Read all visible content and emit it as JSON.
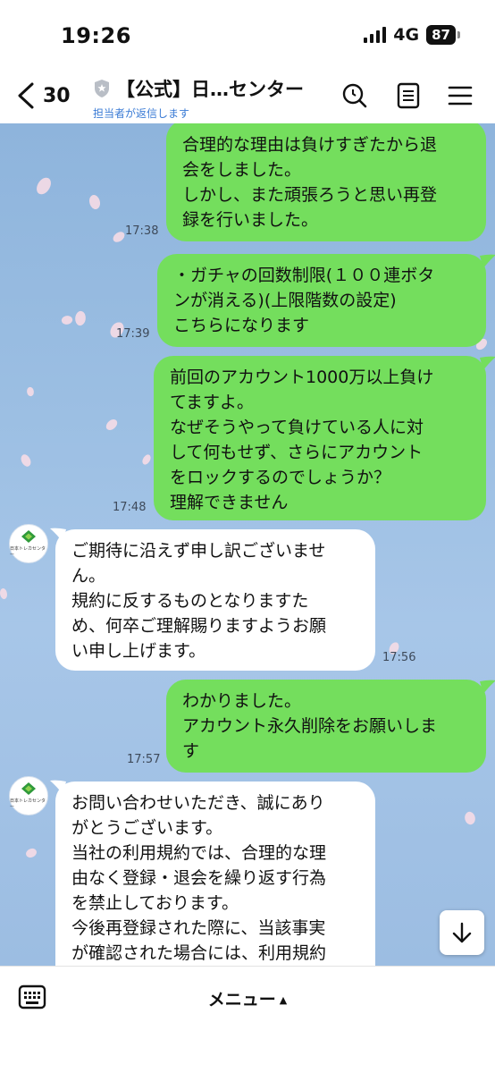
{
  "status_bar": {
    "time": "19:26",
    "network": "4G",
    "battery": "87"
  },
  "header": {
    "back_count": "30",
    "title": "【公式】日…センター",
    "subtitle": "担当者が返信します",
    "icons": [
      "search-icon",
      "notes-icon",
      "menu-icon"
    ]
  },
  "messages": [
    {
      "side": "out",
      "text": "合理的な理由は負けすぎたから退\n会をしました。\nしかし、また頑張ろうと思い再登\n録を行いました。",
      "time": "17:38"
    },
    {
      "side": "out",
      "text": "・ガチャの回数制限(１００連ボタ\nンが消える)(上限階数の設定)\nこちらになります",
      "time": "17:39"
    },
    {
      "side": "out",
      "text": "前回のアカウント1000万以上負け\nてますよ。\nなぜそうやって負けている人に対\nして何もせず、さらにアカウント\nをロックするのでしょうか？\n理解できません",
      "time": "17:48"
    },
    {
      "side": "in",
      "text": "ご期待に沿えず申し訳ございませ\nん。\n規約に反するものとなりますた\nめ、何卒ご理解賜りますようお願\nい申し上げます。",
      "time": "17:56"
    },
    {
      "side": "out",
      "text": "わかりました。\nアカウント永久削除をお願いしま\nす",
      "time": "17:57"
    },
    {
      "side": "in",
      "text": "お問い合わせいただき、誠にあり\nがとうございます。\n当社の利用規約では、合理的な理\n由なく登録・退会を繰り返す行為\nを禁止しております。\n今後再登録された際に、当該事実\nが確認された場合には、利用規約\nに基づきご入会をお断りするか、",
      "time": ""
    }
  ],
  "avatar": {
    "text": "日本トレカセンター"
  },
  "footer": {
    "menu_label": "メニュー",
    "menu_caret": "▲"
  },
  "colors": {
    "outgoing": "#74de5d",
    "incoming": "#ffffff",
    "chat_bg": "#9cbfe3",
    "accent": "#3a7bd5"
  }
}
